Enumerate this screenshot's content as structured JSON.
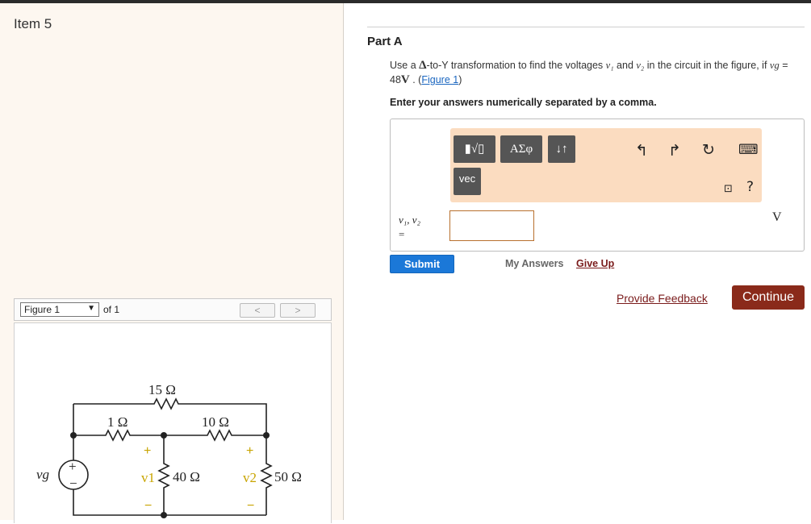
{
  "item": {
    "title": "Item 5"
  },
  "figure": {
    "select_label": "Figure 1",
    "of_label": "of 1",
    "prev": "<",
    "next": ">",
    "circuit": {
      "r_top": "15 Ω",
      "r1": "1 Ω",
      "r2": "10 Ω",
      "r3": "40 Ω",
      "r4": "50 Ω",
      "source": "vg",
      "v1": "v1",
      "v2": "v2",
      "plus": "+",
      "minus": "−"
    }
  },
  "part": {
    "title": "Part A",
    "question": {
      "t1": "Use a ",
      "delta": "Δ",
      "t2": "-to-Y transformation to find the voltages ",
      "v1": "v₁",
      "t3": " and ",
      "v2": "v₂",
      "t4": " in the circuit in the figure, if ",
      "vg": "vg",
      "t5": " = 48",
      "unit": "V",
      "t6": " . (",
      "figure_link": "Figure 1",
      "t7": ")"
    },
    "instruction": "Enter your answers numerically separated by a comma."
  },
  "toolbar": {
    "templates_label": "▮√▯",
    "symbols_label": "ΑΣφ",
    "arrows_label": "↓↑",
    "vec_label": "vec",
    "undo_icon": "↰",
    "redo_icon": "↱",
    "reset_icon": "↻",
    "keyboard_icon": "⌨",
    "small_icon": "⊡",
    "help_label": "?"
  },
  "answer": {
    "label_line1": "v₁, v₂",
    "label_line2": "=",
    "value": "",
    "unit": "V"
  },
  "actions": {
    "submit": "Submit",
    "my_answers": "My Answers",
    "give_up": "Give Up",
    "feedback": "Provide Feedback",
    "continue": "Continue"
  }
}
